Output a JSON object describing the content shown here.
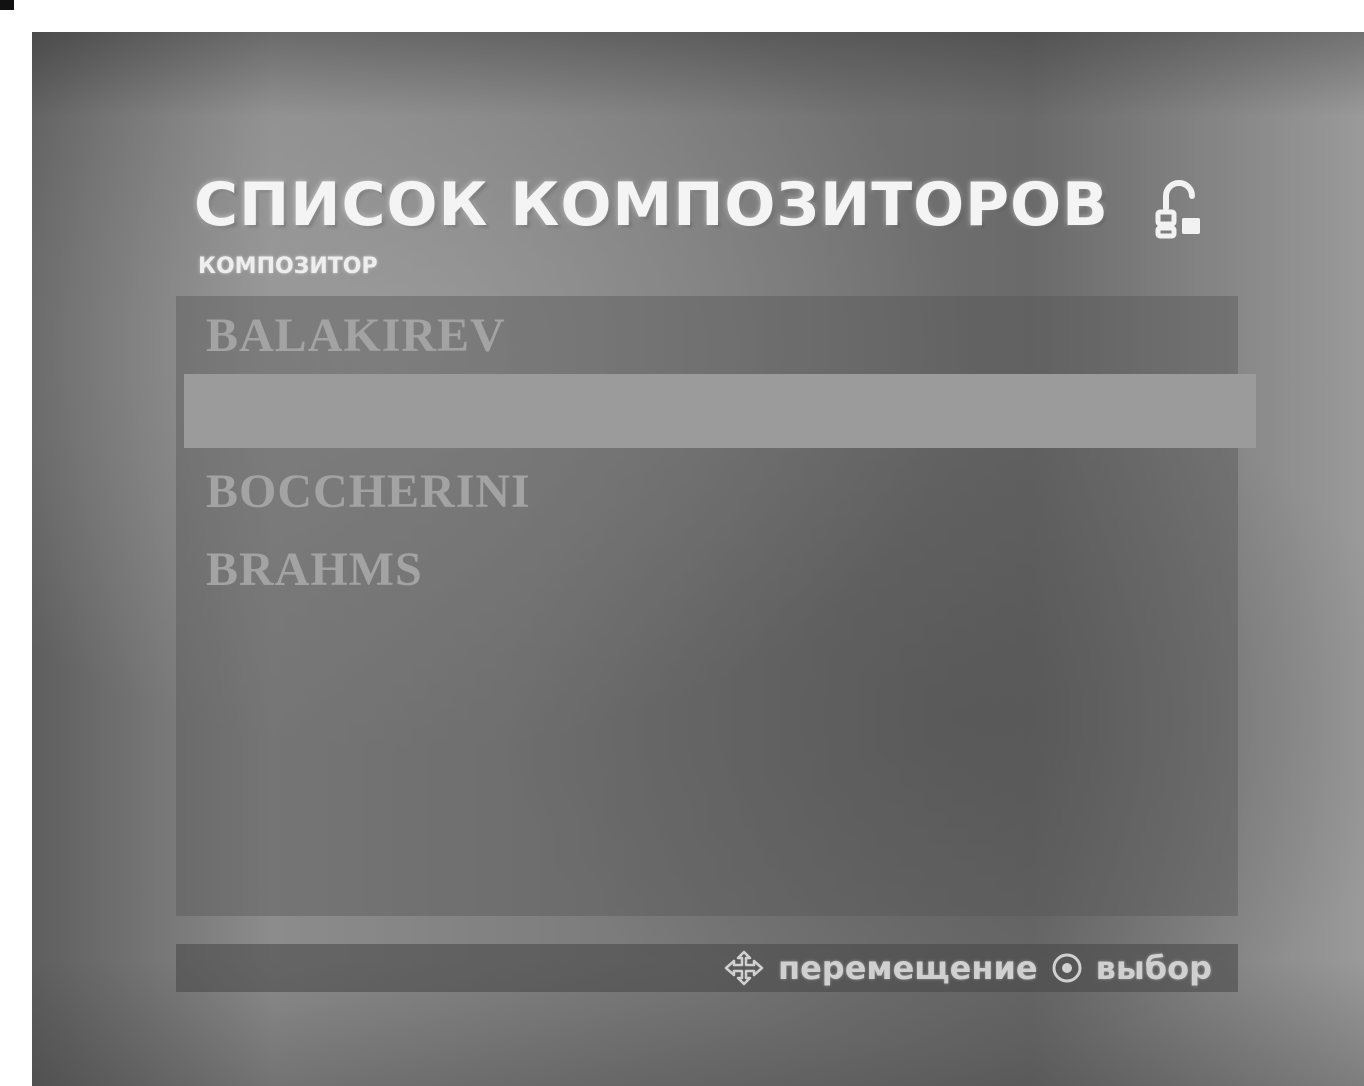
{
  "screen": {
    "title": "СПИСОК КОМПОЗИТОРОВ",
    "subtitle": "КОМПОЗИТОР",
    "status_icon": "disc-lock-icon"
  },
  "composer_list": {
    "items": [
      {
        "label": "BALAKIREV",
        "selected": false
      },
      {
        "label": "",
        "selected": true
      },
      {
        "label": "BOCCHERINI",
        "selected": false
      },
      {
        "label": "BRAHMS",
        "selected": false
      }
    ]
  },
  "footer": {
    "move_icon": "directional-arrows-icon",
    "move_label": "перемещение",
    "select_icon": "enter-button-icon",
    "select_label": "выбор"
  },
  "colors": {
    "highlight": "#9b9b9b",
    "item_text": "#a3a3a3",
    "title_text": "#f4f4f4"
  }
}
